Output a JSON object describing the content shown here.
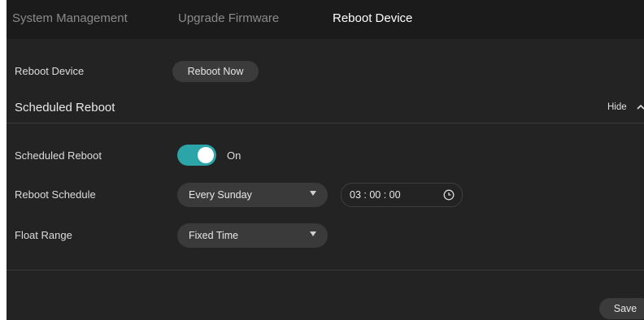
{
  "tabs": [
    {
      "label": "System Management"
    },
    {
      "label": "Upgrade Firmware"
    },
    {
      "label": "Reboot Device"
    }
  ],
  "reboot_device": {
    "label": "Reboot Device",
    "button_label": "Reboot Now"
  },
  "scheduled_section": {
    "title": "Scheduled Reboot",
    "hide_label": "Hide"
  },
  "scheduled_reboot": {
    "label": "Scheduled Reboot",
    "toggle_state": "On"
  },
  "reboot_schedule": {
    "label": "Reboot Schedule",
    "selected": "Every Sunday",
    "time_value": "03 : 00 : 00"
  },
  "float_range": {
    "label": "Float Range",
    "selected": "Fixed Time"
  },
  "footer": {
    "save_label": "Save"
  },
  "colors": {
    "background": "#232323",
    "tab_bar": "#1b1b1b",
    "accent": "#2ba5a8",
    "control": "#3a3a3a"
  },
  "icons": {
    "dropdown": "caret-down-icon",
    "time": "clock-icon",
    "hide": "chevron-up-icon"
  }
}
